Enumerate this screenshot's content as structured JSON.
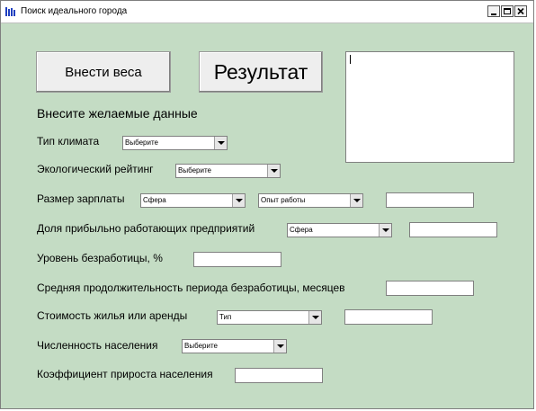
{
  "window": {
    "title": "Поиск идеального города"
  },
  "buttons": {
    "weights": "Внести веса",
    "result": "Результат"
  },
  "form": {
    "heading": "Внесите желаемые данные",
    "climate": {
      "label": "Тип климата",
      "select": "Выберите"
    },
    "eco": {
      "label": "Экологический рейтинг",
      "select": "Выберите"
    },
    "salary": {
      "label": "Размер зарплаты",
      "select1": "Сфера",
      "select2": "Опыт работы",
      "input": ""
    },
    "profit": {
      "label": "Доля прибыльно работающих предприятий",
      "select": "Сфера",
      "input": ""
    },
    "unemployment": {
      "label": "Уровень безработицы, %",
      "input": ""
    },
    "duration": {
      "label": "Средняя продолжительность периода безработицы, месяцев",
      "input": ""
    },
    "housing": {
      "label": "Стоимость жилья или аренды",
      "select": "Тип",
      "input": ""
    },
    "population": {
      "label": "Численность населения",
      "select": "Выберите"
    },
    "growth": {
      "label": "Коэффициент прироста населения",
      "input": ""
    }
  },
  "result_text": ""
}
